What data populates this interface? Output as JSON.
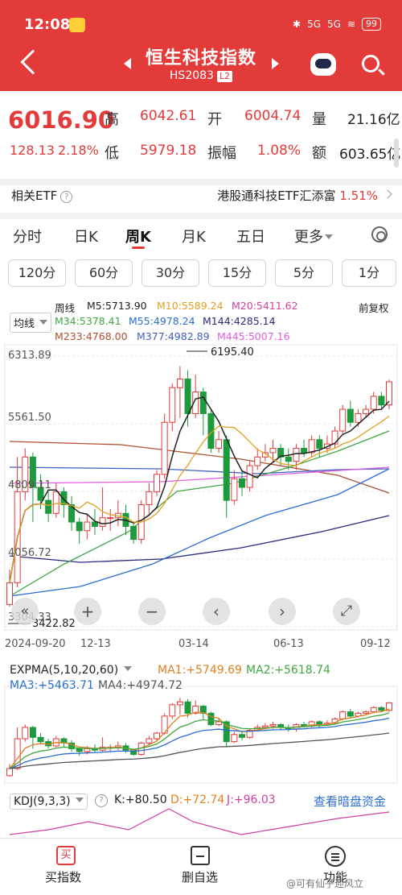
{
  "status": {
    "time": "12:08",
    "battery": "99",
    "net1": "5G",
    "net2": "5G"
  },
  "header": {
    "title": "恒生科技指数",
    "code": "HS2083",
    "level": "L2"
  },
  "quote": {
    "price": "6016.90",
    "change": "128.13",
    "change_pct": "2.18%",
    "high_label": "高",
    "high": "6042.61",
    "open_label": "开",
    "open": "6004.74",
    "vol_label": "量",
    "vol": "21.16亿",
    "low_label": "低",
    "low": "5979.18",
    "amp_label": "振幅",
    "amp": "1.08%",
    "amt_label": "额",
    "amt": "603.65亿"
  },
  "etf": {
    "label": "相关ETF",
    "name": "港股通科技ETF汇添富",
    "pct": "1.51%"
  },
  "tabs": [
    {
      "label": "分时"
    },
    {
      "label": "日K"
    },
    {
      "label": "周K"
    },
    {
      "label": "月K"
    },
    {
      "label": "五日"
    },
    {
      "label": "更多"
    }
  ],
  "periods": [
    "120分",
    "60分",
    "30分",
    "15分",
    "5分",
    "1分"
  ],
  "ma_panel": {
    "selector": "均线",
    "period": "周线",
    "adjust": "前复权",
    "ma": [
      {
        "label": "M5:5713.90",
        "color": "#222222"
      },
      {
        "label": "M10:5589.24",
        "color": "#e0a020"
      },
      {
        "label": "M20:5411.62",
        "color": "#d040a0"
      },
      {
        "label": "M34:5378.41",
        "color": "#3fa83f"
      },
      {
        "label": "M55:4978.24",
        "color": "#2a6fd0"
      },
      {
        "label": "M144:4285.14",
        "color": "#2a2a80"
      },
      {
        "label": "M233:4768.00",
        "color": "#b05030"
      },
      {
        "label": "M377:4982.89",
        "color": "#4060c0"
      },
      {
        "label": "M445:5007.16",
        "color": "#e060e0"
      }
    ]
  },
  "chart_data": {
    "type": "candlestick",
    "y_labels": [
      "6313.89",
      "5561.50",
      "4809.11",
      "4056.72",
      "3304.33"
    ],
    "annotations": [
      "6195.40",
      "3422.82"
    ],
    "x_labels": [
      "2024-09-20",
      "12-13",
      "03-14",
      "06-13",
      "09-12"
    ],
    "candles": [
      {
        "o": 3450,
        "c": 3700,
        "h": 3850,
        "l": 3422.82
      },
      {
        "o": 3700,
        "c": 4750,
        "h": 5150,
        "l": 3650
      },
      {
        "o": 4750,
        "c": 5150,
        "h": 5250,
        "l": 4650
      },
      {
        "o": 5150,
        "c": 4800,
        "h": 5200,
        "l": 4400
      },
      {
        "o": 4800,
        "c": 4650,
        "h": 4950,
        "l": 4550
      },
      {
        "o": 4650,
        "c": 4500,
        "h": 4750,
        "l": 4400
      },
      {
        "o": 4500,
        "c": 4750,
        "h": 4850,
        "l": 4450
      },
      {
        "o": 4750,
        "c": 4600,
        "h": 4800,
        "l": 4450
      },
      {
        "o": 4600,
        "c": 4400,
        "h": 4700,
        "l": 4300
      },
      {
        "o": 4400,
        "c": 4300,
        "h": 4450,
        "l": 4150
      },
      {
        "o": 4300,
        "c": 4400,
        "h": 4500,
        "l": 4200
      },
      {
        "o": 4400,
        "c": 4350,
        "h": 4550,
        "l": 4250
      },
      {
        "o": 4350,
        "c": 4450,
        "h": 4800,
        "l": 4300
      },
      {
        "o": 4450,
        "c": 4450,
        "h": 4550,
        "l": 4300
      },
      {
        "o": 4450,
        "c": 4500,
        "h": 4650,
        "l": 4350
      },
      {
        "o": 4500,
        "c": 4350,
        "h": 4600,
        "l": 4250
      },
      {
        "o": 4350,
        "c": 4200,
        "h": 4400,
        "l": 4150
      },
      {
        "o": 4200,
        "c": 4600,
        "h": 4650,
        "l": 4150
      },
      {
        "o": 4600,
        "c": 4750,
        "h": 4850,
        "l": 4500
      },
      {
        "o": 4750,
        "c": 4950,
        "h": 5000,
        "l": 4700
      },
      {
        "o": 4950,
        "c": 5550,
        "h": 5650,
        "l": 4900
      },
      {
        "o": 5550,
        "c": 5950,
        "h": 6000,
        "l": 5450
      },
      {
        "o": 5950,
        "c": 6050,
        "h": 6195.4,
        "l": 5600
      },
      {
        "o": 6050,
        "c": 5650,
        "h": 6150,
        "l": 5500
      },
      {
        "o": 5650,
        "c": 5900,
        "h": 6100,
        "l": 5600
      },
      {
        "o": 5900,
        "c": 5650,
        "h": 5950,
        "l": 5400
      },
      {
        "o": 5650,
        "c": 5250,
        "h": 5700,
        "l": 5200
      },
      {
        "o": 5250,
        "c": 5350,
        "h": 5450,
        "l": 5200
      },
      {
        "o": 5350,
        "c": 4650,
        "h": 5400,
        "l": 4450
      },
      {
        "o": 4650,
        "c": 4900,
        "h": 5000,
        "l": 4600
      },
      {
        "o": 4900,
        "c": 4800,
        "h": 5000,
        "l": 4700
      },
      {
        "o": 4800,
        "c": 5050,
        "h": 5100,
        "l": 4750
      },
      {
        "o": 5050,
        "c": 5150,
        "h": 5250,
        "l": 5000
      },
      {
        "o": 5150,
        "c": 5200,
        "h": 5300,
        "l": 5100
      },
      {
        "o": 5200,
        "c": 5250,
        "h": 5350,
        "l": 5100
      },
      {
        "o": 5250,
        "c": 5150,
        "h": 5300,
        "l": 5050
      },
      {
        "o": 5150,
        "c": 5100,
        "h": 5250,
        "l": 5000
      },
      {
        "o": 5100,
        "c": 5250,
        "h": 5300,
        "l": 5000
      },
      {
        "o": 5250,
        "c": 5200,
        "h": 5350,
        "l": 5150
      },
      {
        "o": 5200,
        "c": 5350,
        "h": 5400,
        "l": 5150
      },
      {
        "o": 5350,
        "c": 5250,
        "h": 5400,
        "l": 5150
      },
      {
        "o": 5250,
        "c": 5300,
        "h": 5400,
        "l": 5200
      },
      {
        "o": 5300,
        "c": 5450,
        "h": 5500,
        "l": 5250
      },
      {
        "o": 5450,
        "c": 5700,
        "h": 5750,
        "l": 5400
      },
      {
        "o": 5700,
        "c": 5550,
        "h": 5800,
        "l": 5500
      },
      {
        "o": 5550,
        "c": 5650,
        "h": 5700,
        "l": 5500
      },
      {
        "o": 5650,
        "c": 5700,
        "h": 5750,
        "l": 5600
      },
      {
        "o": 5700,
        "c": 5850,
        "h": 5900,
        "l": 5650
      },
      {
        "o": 5850,
        "c": 5750,
        "h": 5900,
        "l": 5700
      },
      {
        "o": 5750,
        "c": 6016.9,
        "h": 6042.61,
        "l": 5700
      }
    ]
  },
  "chart_controls": [
    "«",
    "+",
    "−",
    "‹",
    "›",
    "⤢"
  ],
  "expma": {
    "label": "EXPMA(5,10,20,60)",
    "items": [
      {
        "label": "MA1:+5749.69",
        "color": "#e08020"
      },
      {
        "label": "MA2:+5618.74",
        "color": "#3fa83f"
      },
      {
        "label": "MA3:+5463.71",
        "color": "#2a6fd0"
      },
      {
        "label": "MA4:+4974.72",
        "color": "#555555"
      }
    ]
  },
  "kdj": {
    "label": "KDJ(9,3,3)",
    "k": "K:+80.50",
    "d": "D:+72.74",
    "j": "J:+96.03",
    "link": "查看暗盘资金"
  },
  "bottom": {
    "buy": "买指数",
    "remove": "删自选",
    "func": "功能",
    "buy_icon": "买"
  },
  "watermark": "@可有仙子迎风立"
}
